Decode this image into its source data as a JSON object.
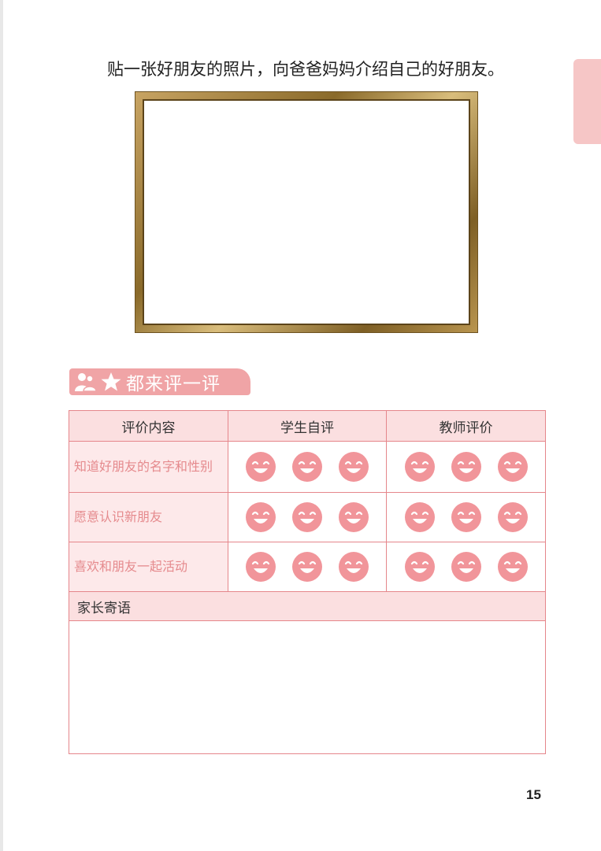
{
  "instruction": "贴一张好朋友的照片，向爸爸妈妈介绍自己的好朋友。",
  "section_title": "都来评一评",
  "table": {
    "headers": [
      "评价内容",
      "学生自评",
      "教师评价"
    ],
    "rows": [
      {
        "criterion": "知道好朋友的名字和性别"
      },
      {
        "criterion": "愿意认识新朋友"
      },
      {
        "criterion": "喜欢和朋友一起活动"
      }
    ],
    "parent_comment_label": "家长寄语"
  },
  "page_number": "15",
  "colors": {
    "accent_pink": "#f0a4a6",
    "face_pink": "#f1959a",
    "table_border": "#e5868b",
    "frame_gold": "#a88444"
  },
  "icons": [
    "people-icon",
    "star-icon",
    "smiley-face-icon"
  ]
}
